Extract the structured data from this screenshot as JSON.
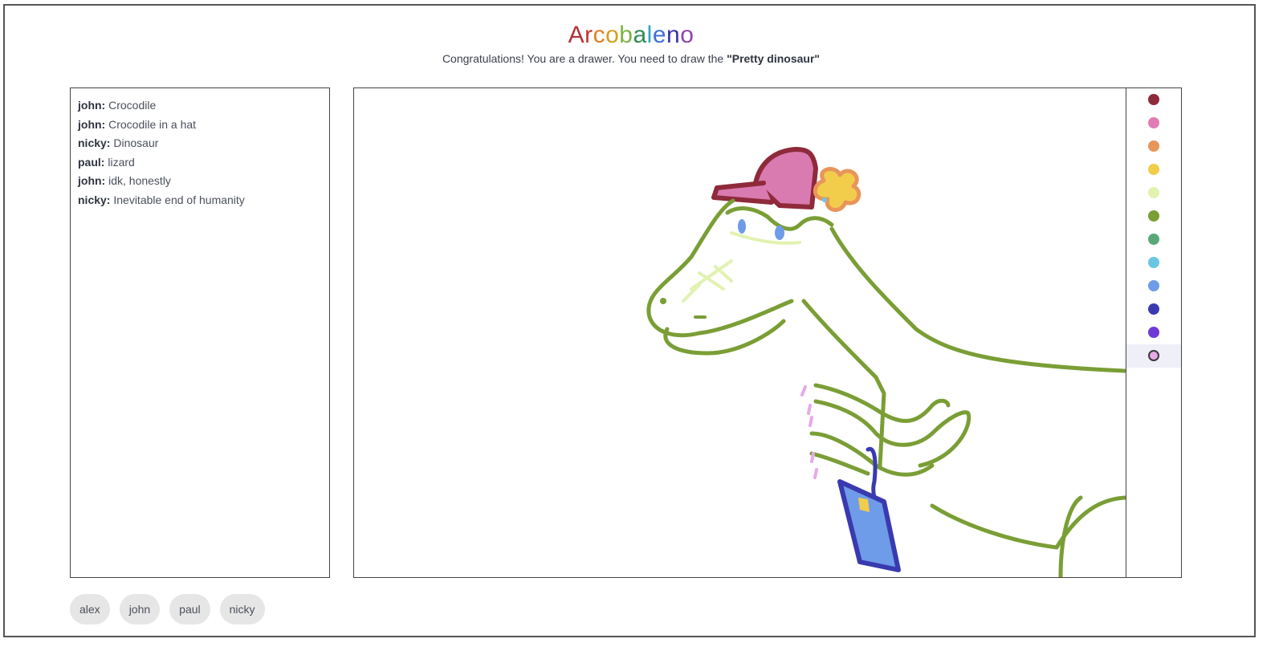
{
  "app": {
    "title_letters": [
      "A",
      "r",
      "c",
      "o",
      "b",
      "a",
      "l",
      "e",
      "n",
      "o"
    ],
    "title_colors": [
      "#b33236",
      "#c0392b",
      "#e67e22",
      "#d4a017",
      "#7cb342",
      "#2e8b57",
      "#2aa6c9",
      "#3f6fd8",
      "#3a32a8",
      "#8e44ad"
    ]
  },
  "header": {
    "message_prefix": "Congratulations! You are a drawer. You need to draw the ",
    "word": "\"Pretty dinosaur\""
  },
  "chat": {
    "messages": [
      {
        "user": "john:",
        "text": "Crocodile"
      },
      {
        "user": "john:",
        "text": "Crocodile in a hat"
      },
      {
        "user": "nicky:",
        "text": "Dinosaur"
      },
      {
        "user": "paul:",
        "text": "lizard"
      },
      {
        "user": "john:",
        "text": "idk, honestly"
      },
      {
        "user": "nicky:",
        "text": "Inevitable end of humanity"
      }
    ]
  },
  "palette": {
    "colors": [
      "#8e2a3a",
      "#e27bb3",
      "#e8955a",
      "#f2cd4b",
      "#e2f2b0",
      "#7a9e35",
      "#5aa87a",
      "#6bc6e3",
      "#6f9ce8",
      "#3a3ab0",
      "#6f3ad8",
      "#e7a9e8"
    ],
    "selected_index": 11,
    "icon": "color-swatch-icon"
  },
  "players": [
    "alex",
    "john",
    "paul",
    "nicky"
  ]
}
